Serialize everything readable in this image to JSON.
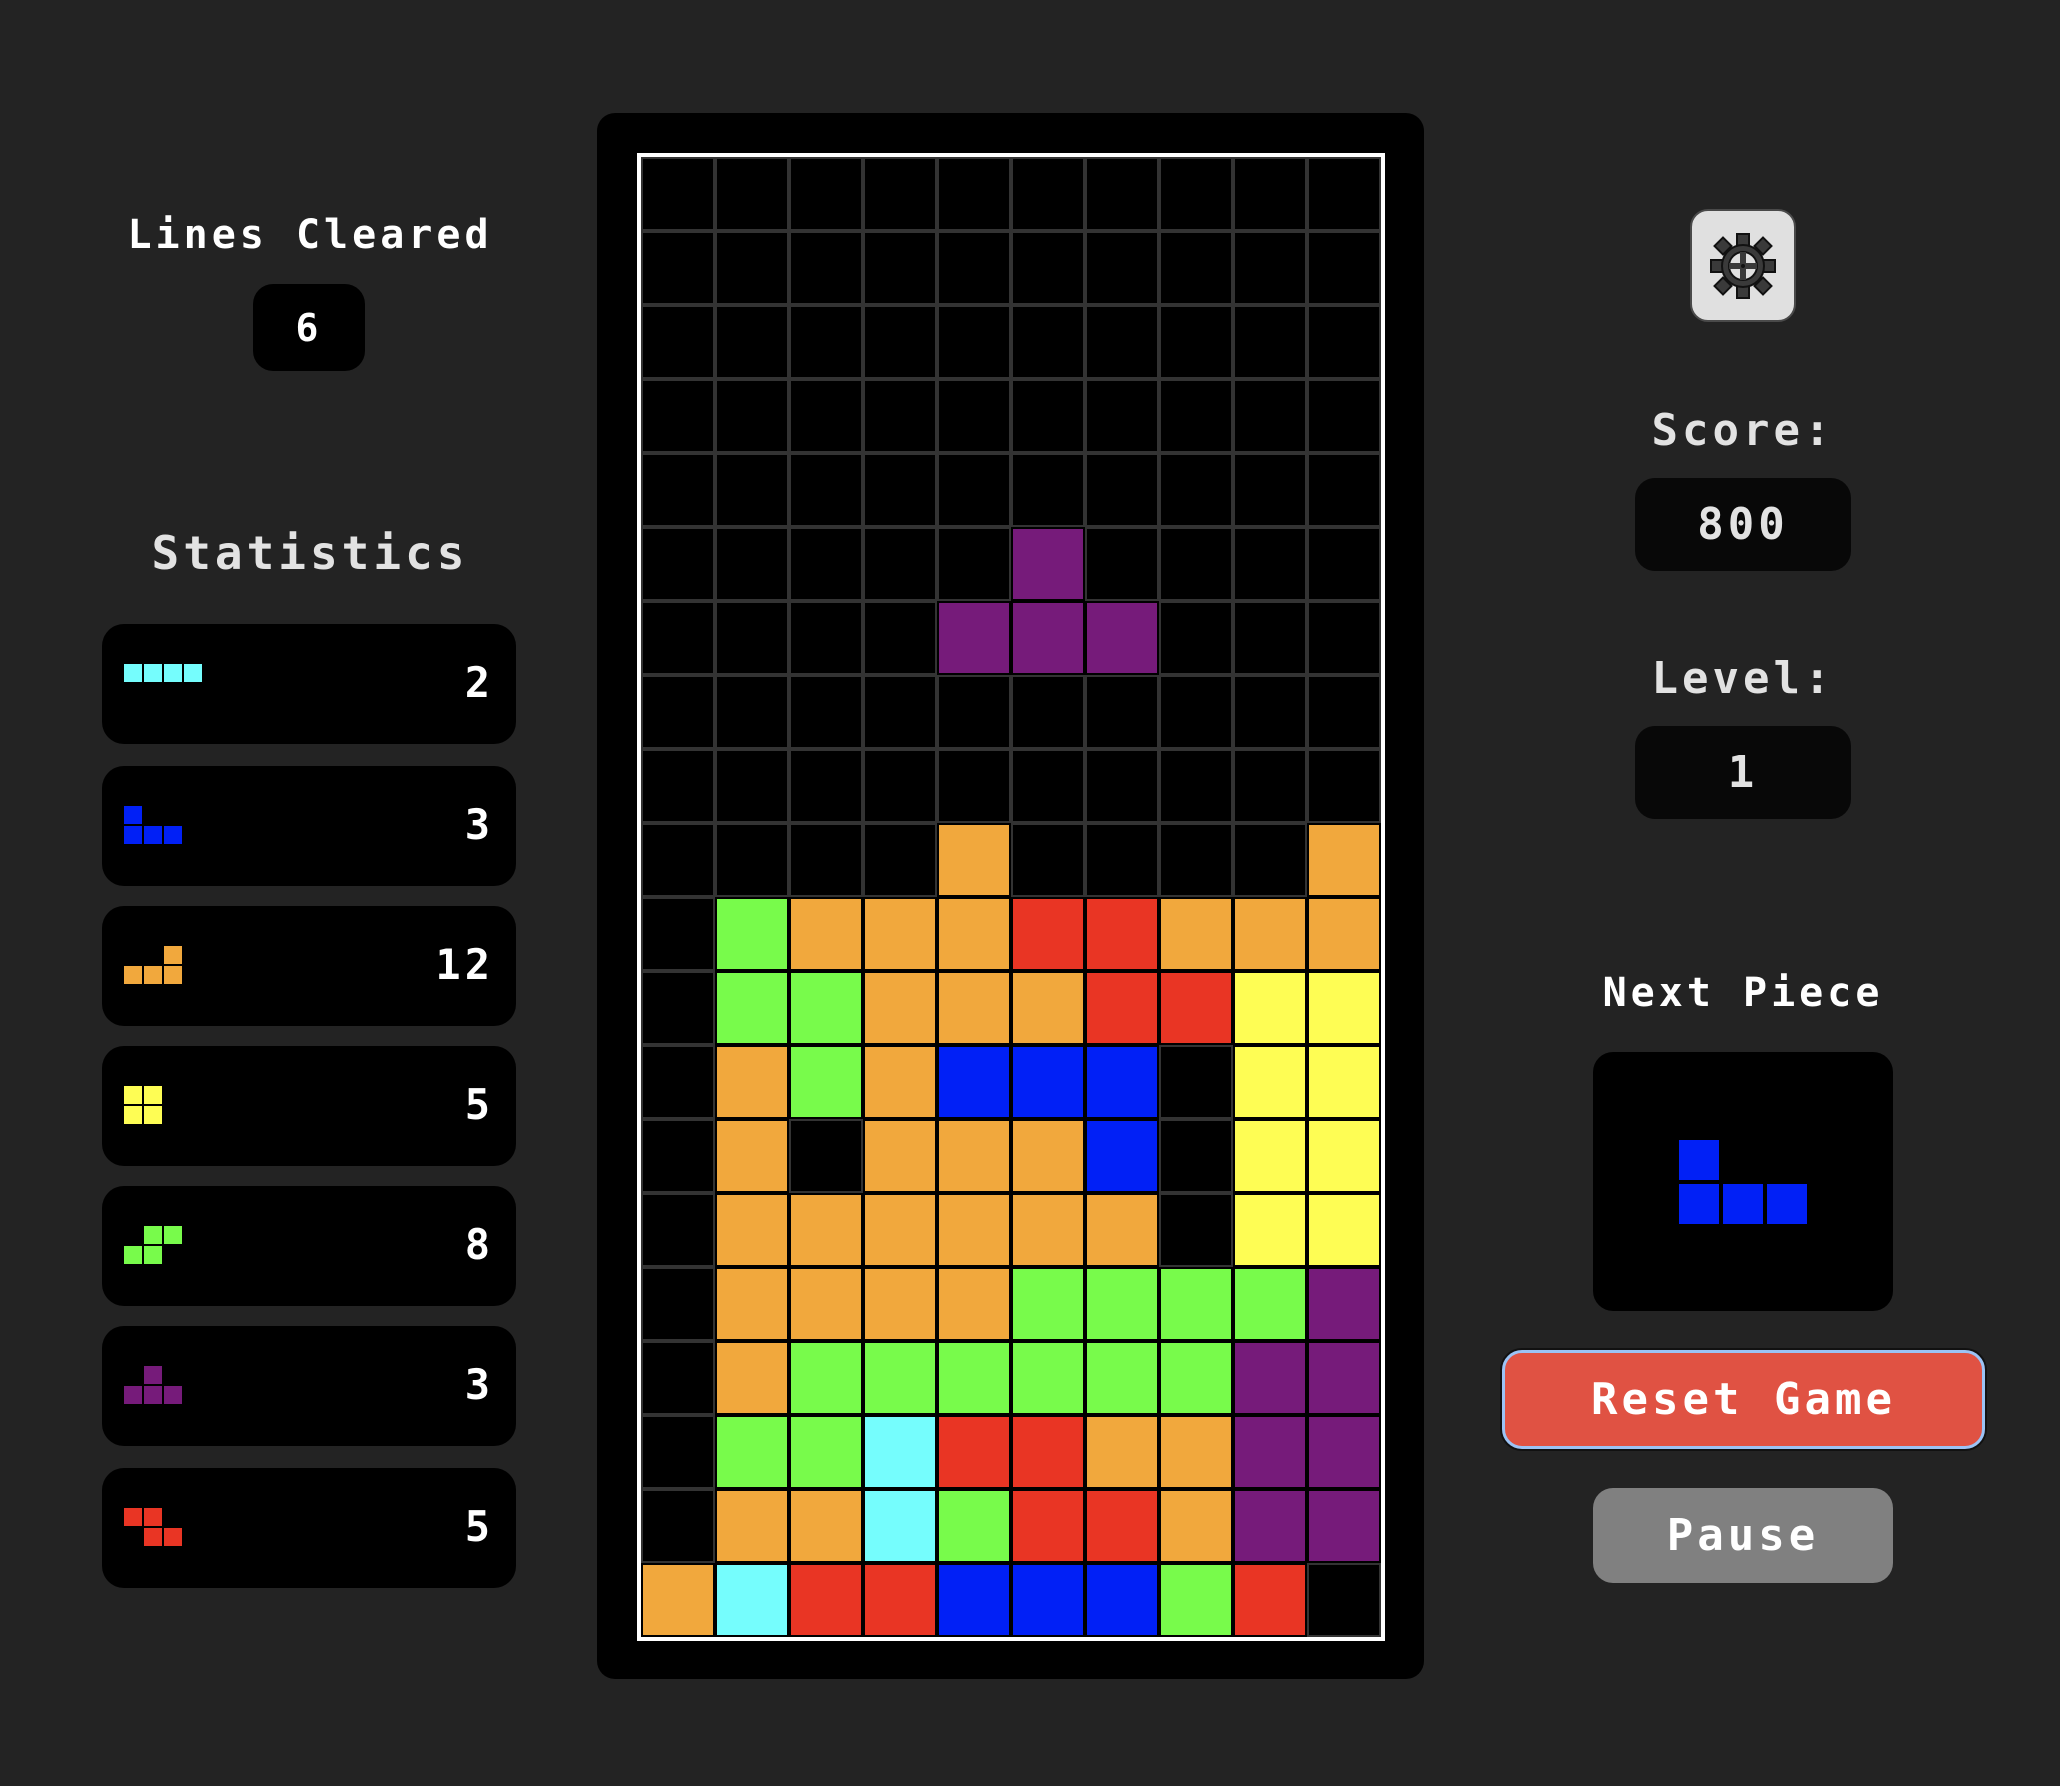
{
  "lines_cleared": {
    "label": "Lines Cleared",
    "value": "6"
  },
  "statistics": {
    "title": "Statistics",
    "items": [
      {
        "piece": "I",
        "color": "#75fdfd",
        "count": "2"
      },
      {
        "piece": "J",
        "color": "#0120f6",
        "count": "3"
      },
      {
        "piece": "L",
        "color": "#f1a83d",
        "count": "12"
      },
      {
        "piece": "O",
        "color": "#fefd54",
        "count": "5"
      },
      {
        "piece": "S",
        "color": "#78fb4b",
        "count": "8"
      },
      {
        "piece": "T",
        "color": "#761b7a",
        "count": "3"
      },
      {
        "piece": "Z",
        "color": "#e93524",
        "count": "5"
      }
    ]
  },
  "settings": {
    "icon": "gear-icon"
  },
  "score": {
    "label": "Score:",
    "value": "800"
  },
  "level": {
    "label": "Level:",
    "value": "1"
  },
  "next_piece": {
    "label": "Next Piece",
    "piece": "J",
    "color": "#0120f6"
  },
  "buttons": {
    "reset": "Reset Game",
    "pause": "Pause"
  },
  "board": {
    "cols": 10,
    "rows": 20,
    "colors": {
      "I": "#75fdfd",
      "J": "#0120f6",
      "L": "#f1a83d",
      "O": "#fefd54",
      "S": "#78fb4b",
      "T": "#761b7a",
      "Z": "#e93524"
    },
    "active_piece": {
      "type": "T",
      "cells": [
        [
          5,
          5
        ],
        [
          6,
          4
        ],
        [
          6,
          5
        ],
        [
          6,
          6
        ]
      ]
    },
    "grid": [
      "..........",
      "..........",
      "..........",
      "..........",
      "..........",
      "..........",
      "..........",
      "..........",
      "..........",
      "....L....L",
      ".SLLLZZLLL",
      ".SSLLLZZOO",
      ".LSLJJJ.OO",
      ".L.LLLJ.OO",
      ".LLLLLL.OO",
      ".LLLLSSSST",
      ".LSSSSSSTT",
      ".SSIZZLLTT",
      ".LLISZZLTT",
      "LIZZJJJSZ."
    ]
  }
}
